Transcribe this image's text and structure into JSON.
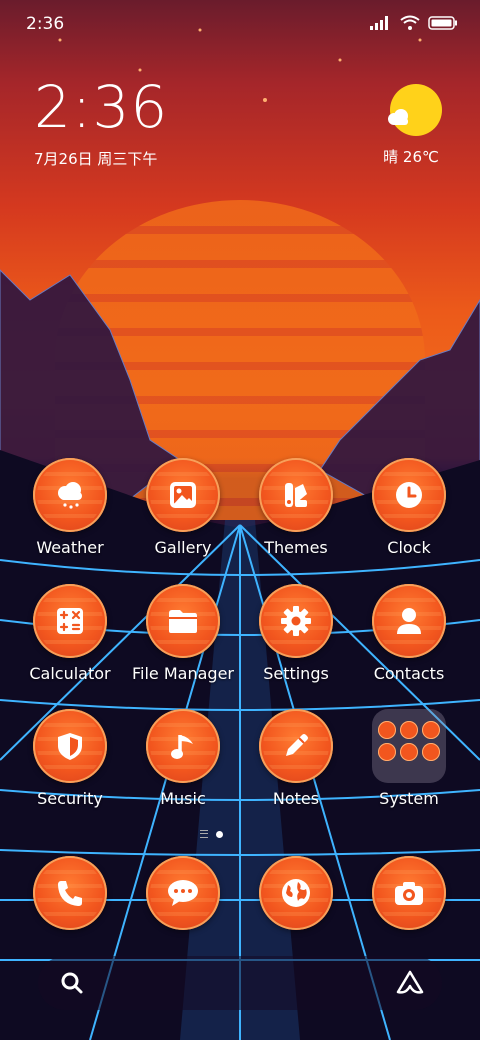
{
  "status": {
    "time": "2:36"
  },
  "clock_widget": {
    "time": "2:36",
    "date": "7月26日 周三下午"
  },
  "weather_widget": {
    "text": "晴 26℃"
  },
  "apps": [
    {
      "label": "Weather",
      "icon": "cloud-rain-icon"
    },
    {
      "label": "Gallery",
      "icon": "image-icon"
    },
    {
      "label": "Themes",
      "icon": "themes-brush-icon"
    },
    {
      "label": "Clock",
      "icon": "clock-icon"
    },
    {
      "label": "Calculator",
      "icon": "calculator-icon"
    },
    {
      "label": "File Manager",
      "icon": "folder-icon"
    },
    {
      "label": "Settings",
      "icon": "gear-icon"
    },
    {
      "label": "Contacts",
      "icon": "person-icon"
    },
    {
      "label": "Security",
      "icon": "shield-icon"
    },
    {
      "label": "Music",
      "icon": "music-note-icon"
    },
    {
      "label": "Notes",
      "icon": "pencil-icon"
    },
    {
      "label": "System",
      "icon": "folder-grid-icon"
    }
  ],
  "dock": [
    {
      "icon": "phone-icon"
    },
    {
      "icon": "message-icon"
    },
    {
      "icon": "globe-icon"
    },
    {
      "icon": "camera-icon"
    }
  ],
  "colors": {
    "icon_orange": "#f2561e",
    "weather_sun": "#ffd21a",
    "grid_blue": "#3fb4ff"
  }
}
